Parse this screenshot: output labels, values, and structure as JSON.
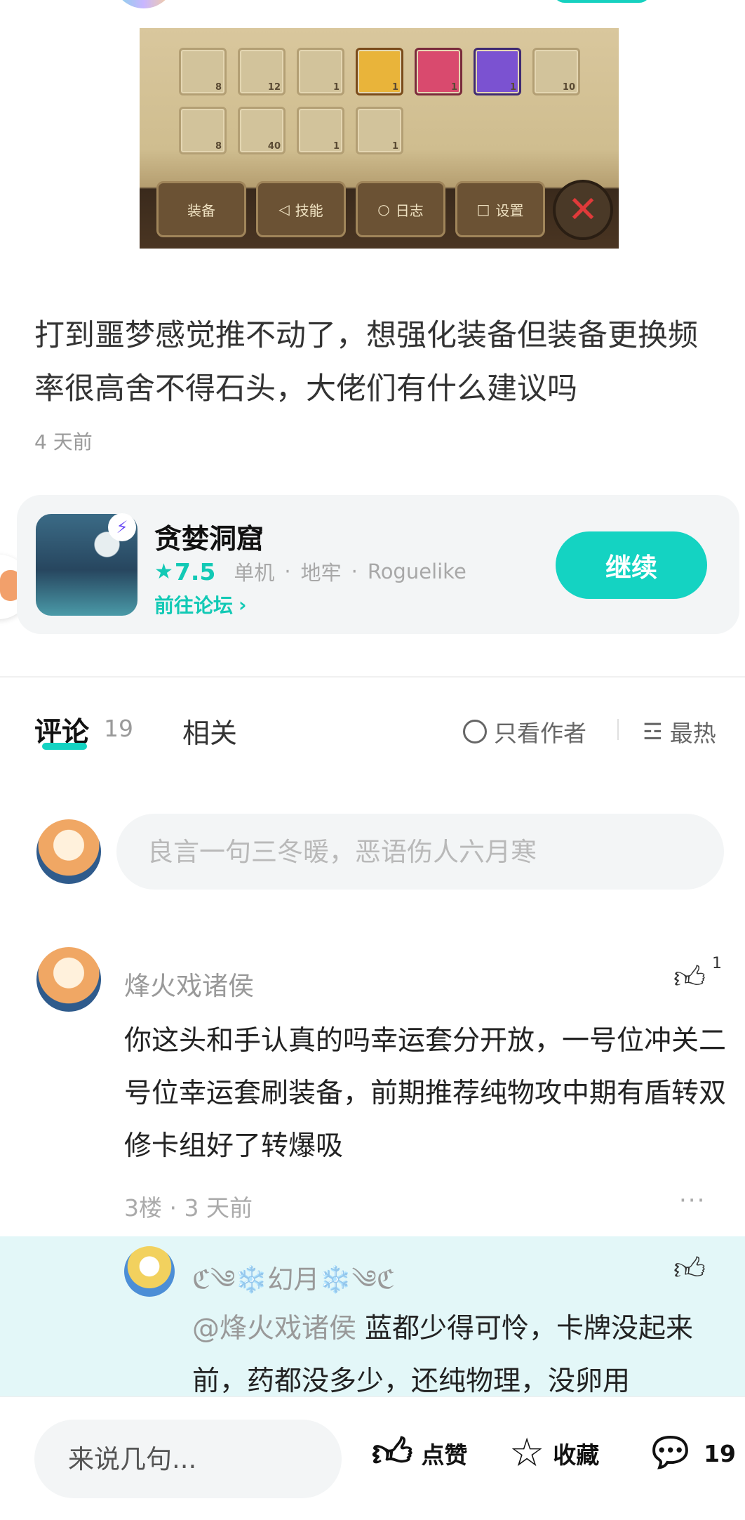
{
  "game_screenshot": {
    "rows": [
      [
        {
          "count": "8",
          "style": "plain"
        },
        {
          "count": "12",
          "style": "plain"
        },
        {
          "count": "1",
          "style": "plain"
        },
        {
          "count": "1",
          "style": "gold"
        },
        {
          "count": "1",
          "style": "red"
        },
        {
          "count": "1",
          "style": "purple"
        },
        {
          "count": "10",
          "style": "plain"
        }
      ],
      [
        {
          "count": "8",
          "style": "plain"
        },
        {
          "count": "40",
          "style": "plain"
        },
        {
          "count": "1",
          "style": "plain"
        },
        {
          "count": "1",
          "style": "plain"
        }
      ]
    ],
    "bar": [
      {
        "label": "装备",
        "icon": "equipment-icon"
      },
      {
        "label": "技能",
        "icon": "skill-icon"
      },
      {
        "label": "日志",
        "icon": "log-icon"
      },
      {
        "label": "设置",
        "icon": "settings-icon"
      }
    ],
    "close_symbol": "✕"
  },
  "post": {
    "text": "打到噩梦感觉推不动了，想强化装备但装备更换频率很高舍不得石头，大佬们有什么建议吗",
    "time": "4 天前"
  },
  "game_card": {
    "name": "贪婪洞窟",
    "rating": "7.5",
    "tags": [
      "单机",
      "地牢",
      "Roguelike"
    ],
    "forum_link": "前往论坛",
    "continue_label": "继续",
    "accent": "#14d3c2"
  },
  "tabs": {
    "comments_label": "评论",
    "comments_count": "19",
    "related_label": "相关",
    "author_only": "只看作者",
    "sort": "最热"
  },
  "comment_input": {
    "placeholder": "良言一句三冬暖，恶语伤人六月寒"
  },
  "comment": {
    "user": "烽火戏诸侯",
    "likes": "1",
    "body": "你这头和手认真的吗幸运套分开放，一号位冲关二号位幸运套刷装备，前期推荐纯物攻中期有盾转双修卡组好了转爆吸",
    "meta": "3楼 · 3 天前",
    "more": "···"
  },
  "reply": {
    "user": "ℭ༄❄️幻月❄️༄ℭ",
    "mention": "@烽火戏诸侯",
    "body": "蓝都少得可怜，卡牌没起来前，药都没多少，还纯物理，没卵用"
  },
  "bottom_bar": {
    "input_placeholder": "来说几句...",
    "like_label": "点赞",
    "favorite_label": "收藏",
    "comment_count": "19"
  }
}
